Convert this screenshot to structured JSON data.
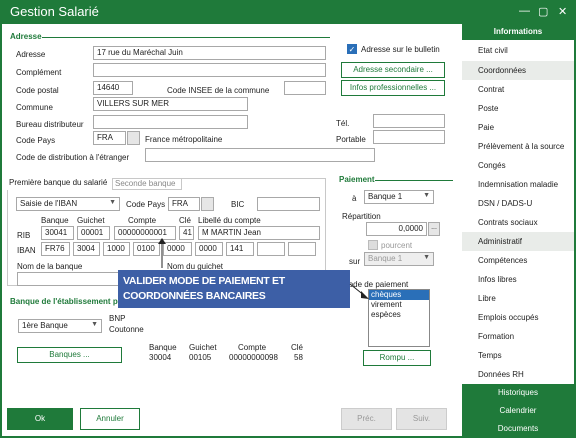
{
  "window": {
    "title": "Gestion Salarié"
  },
  "adresse": {
    "section_title": "Adresse",
    "adresse_label": "Adresse",
    "adresse_value": "17 rue du Maréchal Juin",
    "complement_label": "Complément",
    "complement_value": "",
    "code_postal_label": "Code postal",
    "code_postal_value": "14640",
    "insee_label": "Code INSEE de la commune",
    "insee_value": "",
    "commune_label": "Commune",
    "commune_value": "VILLERS SUR MER",
    "bureau_label": "Bureau distributeur",
    "bureau_value": "",
    "code_pays_label": "Code Pays",
    "code_pays_value": "FRA",
    "pays_name": "France métropolitaine",
    "code_distrib_label": "Code de distribution à l'étranger",
    "code_distrib_value": "",
    "tel_label": "Tél.",
    "tel_value": "",
    "portable_label": "Portable",
    "portable_value": "",
    "bulletin_label": "Adresse sur le bulletin",
    "bulletin_checked": true,
    "adresse_secondaire_btn": "Adresse secondaire ...",
    "infos_pro_btn": "Infos professionnelles ..."
  },
  "banque": {
    "tab1": "Première banque du salarié",
    "tab2": "Seconde banque",
    "saisie_value": "Saisie de l'IBAN",
    "code_pays_label": "Code Pays",
    "code_pays_value": "FRA",
    "bic_label": "BIC",
    "bic_value": "",
    "col_banque": "Banque",
    "col_guichet": "Guichet",
    "col_compte": "Compte",
    "col_cle": "Clé",
    "col_libelle": "Libellé du compte",
    "rib_label": "RIB",
    "rib_banque": "30041",
    "rib_guichet": "00001",
    "rib_compte": "00000000001",
    "rib_cle": "41",
    "rib_libelle": "M MARTIN Jean",
    "iban_label": "IBAN",
    "iban": [
      "FR76",
      "3004",
      "1000",
      "0100",
      "0000",
      "0000",
      "141",
      "",
      ""
    ],
    "nom_banque_label": "Nom de la banque",
    "nom_guichet_label": "Nom du guichet"
  },
  "etablissement": {
    "section_title": "Banque de l'établissement pay",
    "select_value": "1ère Banque",
    "bank_name": "BNP",
    "bank_city": "Coutonne",
    "col_banque": "Banque",
    "col_guichet": "Guichet",
    "col_compte": "Compte",
    "col_cle": "Clé",
    "banque": "30004",
    "guichet": "00105",
    "compte": "00000000098",
    "cle": "58",
    "banques_btn": "Banques ..."
  },
  "paiement": {
    "section_title": "Paiement",
    "a_label": "à",
    "a_value": "Banque 1",
    "repartition_label": "Répartition",
    "repartition_value": "0,0000",
    "pourcent_label": "pourcent",
    "sur_label": "sur",
    "sur_value": "Banque 1",
    "mode_label": "Mode de paiement",
    "modes": [
      "chèques",
      "virement",
      "espèces"
    ],
    "rompu_btn": "Rompu ..."
  },
  "callout": {
    "line1": "VALIDER MODE DE PAIEMENT ET",
    "line2": "COORDONNÉES BANCAIRES"
  },
  "footer": {
    "ok": "Ok",
    "annuler": "Annuler",
    "prec": "Préc.",
    "suiv": "Suiv."
  },
  "sidebar": {
    "header": "Informations",
    "items": [
      "Etat civil",
      "Coordonnées",
      "Contrat",
      "Poste",
      "Paie",
      "Prélèvement à la source",
      "Congés",
      "Indemnisation maladie",
      "DSN / DADS-U",
      "Contrats sociaux",
      "Administratif",
      "Compétences",
      "Infos libres",
      "Libre",
      "Emplois occupés",
      "Formation",
      "Temps",
      "Données RH"
    ],
    "bottom": [
      "Historiques",
      "Calendrier",
      "Documents"
    ]
  },
  "colors": {
    "accent": "#1f7a3a",
    "callout": "#3d5fa6",
    "selection": "#2a6fb8"
  }
}
